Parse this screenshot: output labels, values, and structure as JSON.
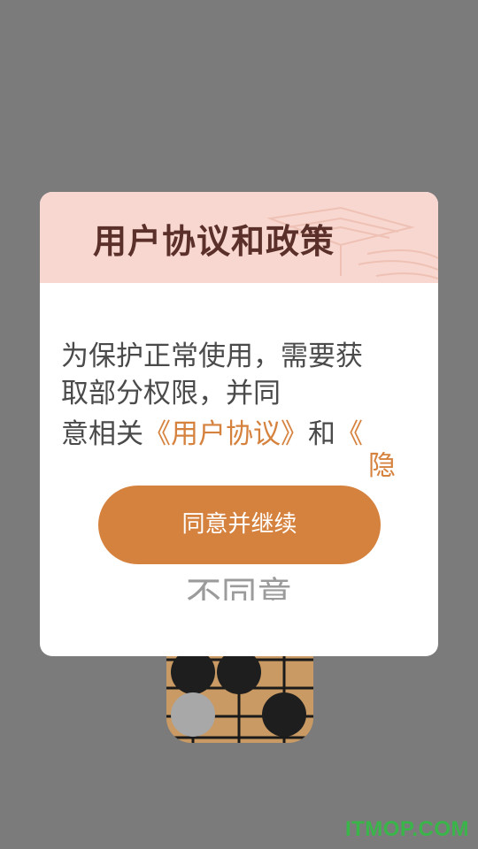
{
  "dialog": {
    "title": "用户协议和政策",
    "body": {
      "line1": "为保护正常使用，需要获",
      "line2": "取部分权限，并同",
      "line3_prefix": "意相关",
      "line3_link": "《用户协议》",
      "line3_and": "和",
      "line3_link2_start": "《",
      "line4_link2_cont": "隐"
    },
    "agree_button": "同意并继续",
    "disagree_button": "不同意"
  },
  "watermark": "ITMOP.COM",
  "colors": {
    "accent": "#d6823f",
    "header_bg": "#f7d7cf",
    "title": "#5b302a",
    "overlay": "#7b7b7b",
    "watermark": "#39b54a"
  },
  "icons": [
    "go-board-app-icon"
  ]
}
